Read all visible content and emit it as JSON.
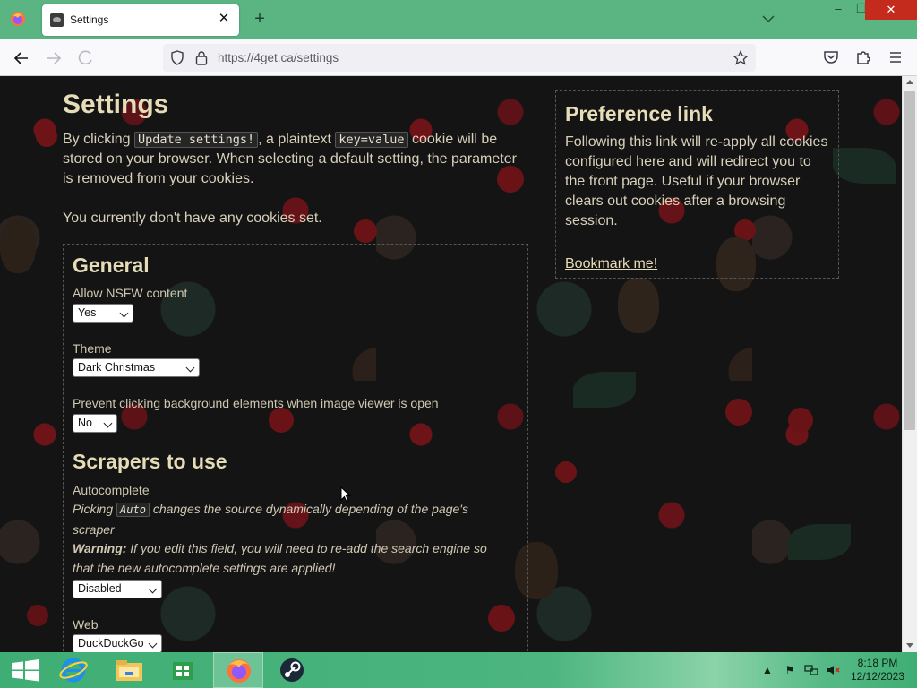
{
  "browser": {
    "tab_title": "Settings",
    "url": "https://4get.ca/settings"
  },
  "page": {
    "title": "Settings",
    "intro": {
      "part1": "By clicking ",
      "code1": "Update settings!",
      "part2": ", a plaintext ",
      "code2": "key=value",
      "part3": " cookie will be stored on your browser. When selecting a default setting, the parameter is removed from your cookies."
    },
    "no_cookies": "You currently don't have any cookies set.",
    "general": {
      "heading": "General",
      "nsfw_label": "Allow NSFW content",
      "nsfw_value": "Yes",
      "theme_label": "Theme",
      "theme_value": "Dark Christmas",
      "prevent_label": "Prevent clicking background elements when image viewer is open",
      "prevent_value": "No"
    },
    "scrapers": {
      "heading": "Scrapers to use",
      "autocomplete_label": "Autocomplete",
      "note1_a": "Picking ",
      "note1_code": "Auto",
      "note1_b": " changes the source dynamically depending of the page's scraper",
      "warning_bold": "Warning:",
      "warning_text": " If you edit this field, you will need to re-add the search engine so that the new autocomplete settings are applied!",
      "autocomplete_value": "Disabled",
      "web_label": "Web",
      "web_value": "DuckDuckGo"
    },
    "preference": {
      "title": "Preference link",
      "text": "Following this link will re-apply all cookies configured here and will redirect you to the front page. Useful if your browser clears out cookies after a browsing session.",
      "link": "Bookmark me!"
    }
  },
  "taskbar": {
    "time": "8:18 PM",
    "date": "12/12/2023"
  },
  "colors": {
    "tabbar": "#5bb583",
    "heading": "#e6dcb8",
    "text": "#d8d0b9",
    "close_red": "#c42b1c"
  }
}
